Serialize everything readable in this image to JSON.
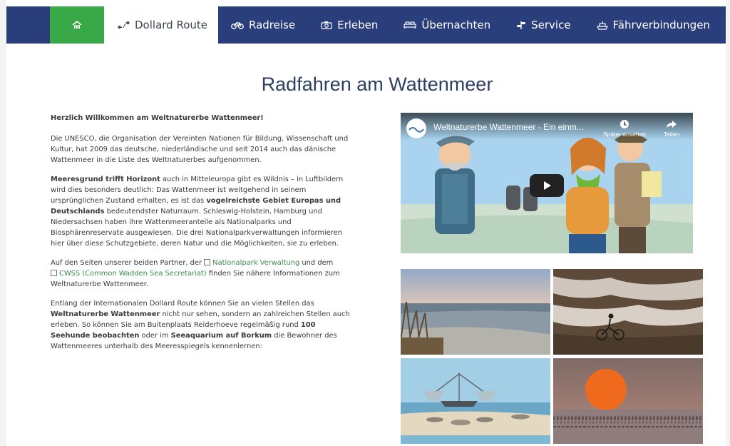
{
  "nav": {
    "home_icon": "home-icon",
    "items": [
      {
        "label": "Dollard Route",
        "icon": "route-icon"
      },
      {
        "label": "Radreise",
        "icon": "bicycle-icon"
      },
      {
        "label": "Erleben",
        "icon": "camera-icon"
      },
      {
        "label": "Übernachten",
        "icon": "bed-icon"
      },
      {
        "label": "Service",
        "icon": "signpost-icon"
      },
      {
        "label": "Fährverbindungen",
        "icon": "ferry-icon"
      }
    ],
    "active": "Dollard Route"
  },
  "page": {
    "title": "Radfahren am Wattenmeer"
  },
  "content": {
    "intro": "Herzlich Willkommen am Weltnaturerbe Wattenmeer!",
    "p1": "Die UNESCO, die Organisation der Vereinten Nationen für Bildung, Wissenschaft und Kultur, hat 2009 das deutsche, niederländische und seit 2014 auch das dänische Wattenmeer in die Liste des Weltnaturerbes aufgenommen.",
    "p2": {
      "b1": "Meeresgrund trifft Horizont",
      "t1": " auch in Mitteleuropa gibt es Wildnis – in Luftbildern wird dies besonders deutlich: Das Wattenmeer ist weitgehend in seinem ursprünglichen Zustand erhalten, es ist das ",
      "b2": "vogelreichste Gebiet Europas und Deutschlands",
      "t2": " bedeutendster Naturraum. Schleswig-Holstein, Hamburg und Niedersachsen haben ihre Wattenmeeranteile als Nationalparks und Biosphärenreservate ausgewiesen. Die drei Nationalparkverwaltungen informieren hier über diese Schutzgebiete, deren Natur und die Möglichkeiten, sie zu erleben."
    },
    "p3": {
      "t1": "Auf den Seiten unserer beiden Partner, der ",
      "link1": "Nationalpark Verwaltung",
      "t2": " und dem ",
      "link2": "CWSS (Common Wadden Sea Secretariat)",
      "t3": " finden Sie nähere Informationen zum Weltnaturerbe Wattenmeer."
    },
    "p4": {
      "t1": "Entlang der Internationalen Dollard Route können Sie an vielen Stellen das ",
      "b1": "Weltnaturerbe Wattenmeer",
      "t2": " nicht nur sehen, sondern an zahlreichen Stellen auch erleben. So können Sie am Buitenplaats Reiderhoeve regelmäßig rund ",
      "b2": "100 Seehunde beobachten",
      "t3": " oder im ",
      "b3": "Seeaquarium auf Borkum",
      "t4": " die Bewohner des Wattenmeeres unterhalb des Meeresspiegels kennenlernen:"
    }
  },
  "video": {
    "title": "Weltnaturerbe Wattenmeer - Ein einm...",
    "watch_later": "Später ansehen",
    "share": "Teilen"
  },
  "colors": {
    "nav_bg": "#2b3e7c",
    "home_bg": "#39a847",
    "link": "#3d8c4e",
    "title": "#2e3f63"
  }
}
